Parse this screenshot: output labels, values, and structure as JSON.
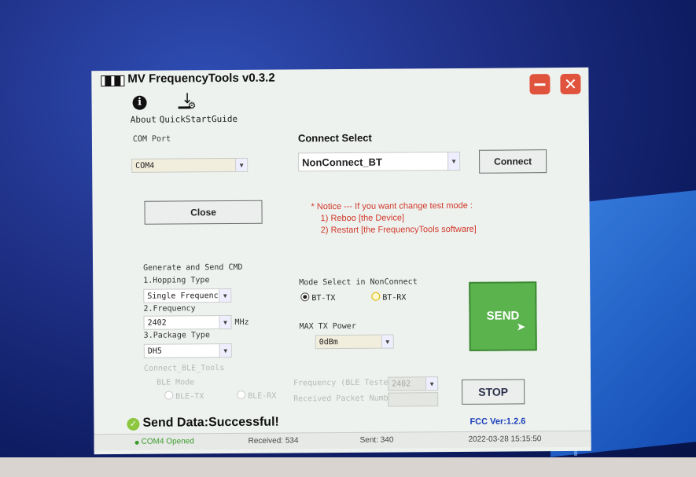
{
  "window": {
    "title": "MV FrequencyTools v0.3.2"
  },
  "toolbar": {
    "about_label": "About",
    "quickstart_label": "QuickStartGuide"
  },
  "com_port": {
    "label": "COM Port",
    "value": "COM4",
    "close_button": "Close"
  },
  "connect_select": {
    "label": "Connect Select",
    "value": "NonConnect_BT",
    "connect_button": "Connect"
  },
  "notice": {
    "line1": "* Notice --- If you want change test mode :",
    "line2": "1) Reboo [the Device]",
    "line3": "2) Restart [the FrequencyTools software]"
  },
  "generate": {
    "section_label": "Generate and Send CMD",
    "hopping_label": "1.Hopping Type",
    "hopping_value": "Single Frequency",
    "frequency_label": "2.Frequency",
    "frequency_value": "2402",
    "frequency_unit": "MHz",
    "package_label": "3.Package Type",
    "package_value": "DH5"
  },
  "mode_select": {
    "label": "Mode Select in NonConnect",
    "option1": "BT-TX",
    "option2": "BT-RX",
    "selected": "BT-TX"
  },
  "max_tx_power": {
    "label": "MAX TX Power",
    "value": "0dBm"
  },
  "connect_ble": {
    "label": "Connect_BLE_Tools",
    "ble_mode_label": "BLE Mode",
    "option1": "BLE-TX",
    "option2": "BLE-RX",
    "frequency_label": "Frequency (BLE Tester)",
    "frequency_value": "2402",
    "packet_label": "Received Packet Number"
  },
  "buttons": {
    "send": "SEND",
    "stop": "STOP"
  },
  "status": {
    "message": "Send Data:Successful!",
    "fcc_version": "FCC Ver:1.2.6",
    "port_state": "COM4 Opened",
    "received": "Received: 534",
    "sent": "Sent: 340",
    "timestamp": "2022-03-28 15:15:50"
  },
  "colors": {
    "send_green": "#5ab34d",
    "close_red": "#e0533d",
    "notice_red": "#d0382a",
    "fcc_blue": "#1a3db8"
  }
}
